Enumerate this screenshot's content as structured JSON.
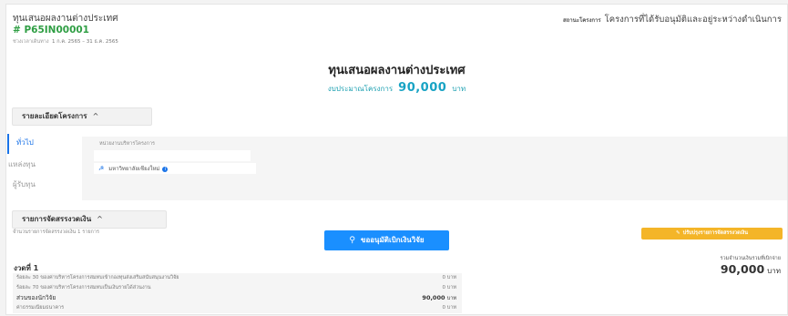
{
  "project": {
    "title": "ทุนเสนอผลงานต่างประเทศ",
    "code": "# P65IN00001",
    "period_label": "ช่วงเวลาเดินทาง",
    "period_value": "1 ก.ค. 2565 – 31 ธ.ค. 2565"
  },
  "status": {
    "label": "สถานะโครงการ",
    "value": "โครงการที่ได้รับอนุมัติและอยู่ระหว่างดำเนินการ"
  },
  "hero": {
    "title": "ทุนเสนอผลงานต่างประเทศ",
    "budget_label": "งบประมาณโครงการ",
    "budget_value": "90,000",
    "budget_unit": "บาท"
  },
  "details_section": {
    "label": "รายละเอียดโครงการ",
    "chevron": "^",
    "tabs": [
      "ทั่วไป",
      "แหล่งทุน",
      "ผู้รับทุน"
    ],
    "active_tab": "ทั่วไป",
    "panel_label": "หน่วยงานบริหารโครงการ",
    "org_name": "มหาวิทยาลัยเชียงใหม่",
    "org_icon": "org-chart-icon",
    "info_icon": "info-icon"
  },
  "allocation_section": {
    "label": "รายการจัดสรรงวดเงิน",
    "chevron": "^",
    "count_text": "จำนวนรายการจัดสรรงวดเงิน 1 รายการ",
    "approve_button": "ขออนุมัติเบิกเงินวิจัย",
    "adjust_button": "ปรับปรุงรายการจัดสรรงวดเงิน",
    "installment_title": "งวดที่ 1",
    "total_label": "รวมจำนวนเงินรวมที่เบิกจ่าย",
    "total_value": "90,000",
    "total_unit": "บาท",
    "rows": [
      {
        "label": "ร้อยละ 30 ของค่าบริหารโครงการสมทบเข้ากองทุนส่งเสริมสนับสนุนงานวิจัย",
        "amount": "0",
        "unit": "บาท"
      },
      {
        "label": "ร้อยละ 70 ของค่าบริหารโครงการสมทบเป็นเงินรายได้ส่วนงาน",
        "amount": "0",
        "unit": "บาท"
      },
      {
        "label": "ส่วนของนักวิจัย",
        "amount": "90,000",
        "unit": "บาท"
      },
      {
        "label": "ค่าธรรมเนียมธนาคาร",
        "amount": "0",
        "unit": "บาท"
      }
    ]
  },
  "colors": {
    "accent_blue": "#1a8fff",
    "accent_green": "#2f9e44",
    "accent_teal": "#18a3c4",
    "warning_yellow": "#f4b528"
  }
}
